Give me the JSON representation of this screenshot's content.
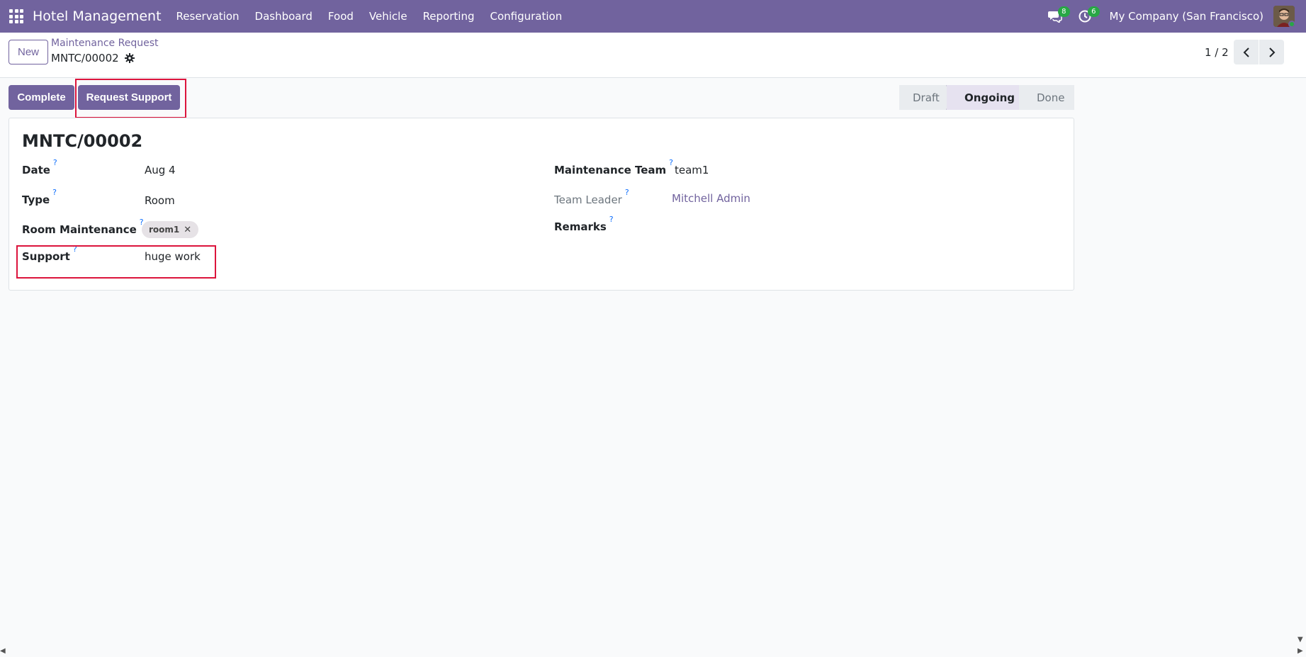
{
  "navbar": {
    "app_name": "Hotel Management",
    "menu": [
      "Reservation",
      "Dashboard",
      "Food",
      "Vehicle",
      "Reporting",
      "Configuration"
    ],
    "messages_count": "8",
    "activities_count": "6",
    "company": "My Company (San Francisco)",
    "accent_color": "#71639e"
  },
  "control_panel": {
    "new_label": "New",
    "breadcrumb_parent": "Maintenance Request",
    "breadcrumb_current": "MNTC/00002",
    "pager_value": "1 / 2"
  },
  "actions": {
    "complete_label": "Complete",
    "request_support_label": "Request Support"
  },
  "status_bar": {
    "steps": [
      "Draft",
      "Ongoing",
      "Done"
    ],
    "active": "Ongoing"
  },
  "form": {
    "title": "MNTC/00002",
    "help_mark": "?",
    "fields": {
      "date": {
        "label": "Date",
        "value": "Aug 4"
      },
      "type": {
        "label": "Type",
        "value": "Room"
      },
      "room_maintenance": {
        "label": "Room Maintenance",
        "tag": "room1"
      },
      "support": {
        "label": "Support",
        "value": "huge work"
      },
      "maintenance_team": {
        "label": "Maintenance Team",
        "value": "team1"
      },
      "team_leader": {
        "label": "Team Leader",
        "value": "Mitchell Admin"
      },
      "remarks": {
        "label": "Remarks",
        "value": ""
      }
    }
  },
  "highlight_color": "#dc143c"
}
